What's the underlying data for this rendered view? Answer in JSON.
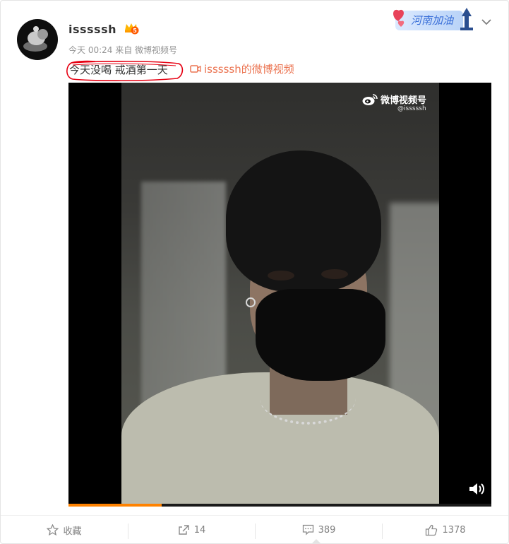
{
  "post": {
    "username": "isssssh",
    "vip_level": "5",
    "time": "今天 00:24",
    "source": "来自 微博视频号",
    "text": "今天没喝 戒酒第一天",
    "video_link_label": "isssssh的微博视频"
  },
  "badge": {
    "label": "河南加油"
  },
  "video": {
    "watermark_brand": "微博视频号",
    "watermark_handle": "@isssssh",
    "progress": 0.22
  },
  "actions": {
    "favorite_label": "收藏",
    "repost_count": "14",
    "comment_count": "389",
    "like_count": "1378"
  },
  "colors": {
    "link": "#eb7350",
    "progress": "#ff8200",
    "annotation": "#e60012"
  },
  "icons": {
    "favorite": "star-icon",
    "repost": "share-arrow-icon",
    "comment": "comment-bubble-icon",
    "like": "thumbs-up-icon",
    "menu": "chevron-down-icon",
    "volume": "speaker-icon"
  }
}
